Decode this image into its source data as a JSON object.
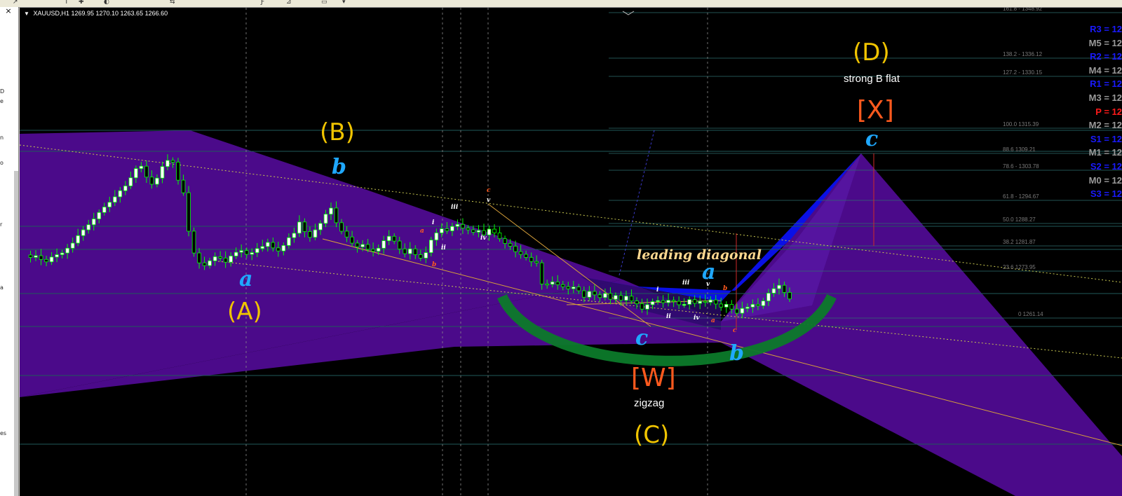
{
  "toolbar": {
    "items": [
      "↗",
      "T",
      "✚",
      "◐",
      "⇆",
      "Ƒ",
      "⊿",
      "▭",
      "▾"
    ]
  },
  "side_panel": {
    "close_glyph": "×",
    "fragments": [
      "D",
      "e",
      "n",
      "o",
      "r",
      "a",
      "es"
    ]
  },
  "chart": {
    "header": {
      "symbol": "XAUUSD,H1",
      "ohlc": "1269.95 1270.10 1263.65 1266.60"
    },
    "fib_levels": [
      {
        "label": "161.8 - 1348.92"
      },
      {
        "label": "138.2 - 1336.12"
      },
      {
        "label": "127.2 - 1330.15"
      },
      {
        "label": "100.0 1315.39"
      },
      {
        "label": "88.6 1309.21"
      },
      {
        "label": "78.6 - 1303.78"
      },
      {
        "label": "61.8 - 1294.67"
      },
      {
        "label": "50.0 1288.27"
      },
      {
        "label": "38.2 1281.87"
      },
      {
        "label": "23.6 1273.95"
      },
      {
        "label": "0 1261.14"
      }
    ],
    "pivots": [
      {
        "label": "R3 = 12",
        "color": "#1a1aff"
      },
      {
        "label": "M5 = 12",
        "color": "#9a9a9a"
      },
      {
        "label": "R2 = 12",
        "color": "#1a1aff"
      },
      {
        "label": "M4 = 12",
        "color": "#9a9a9a"
      },
      {
        "label": "R1 = 12",
        "color": "#1a1aff"
      },
      {
        "label": "M3 = 12",
        "color": "#9a9a9a"
      },
      {
        "label": "P  = 12",
        "color": "#ff1a1a"
      },
      {
        "label": "M2 = 12",
        "color": "#9a9a9a"
      },
      {
        "label": "S1 = 12",
        "color": "#1a1aff"
      },
      {
        "label": "M1 = 12",
        "color": "#9a9a9a"
      },
      {
        "label": "S2 = 12",
        "color": "#1a1aff"
      },
      {
        "label": "M0 = 12",
        "color": "#9a9a9a"
      },
      {
        "label": "S3 = 12",
        "color": "#1a1aff"
      }
    ],
    "labels": {
      "A": "(A)",
      "B": "(B)",
      "C": "(C)",
      "D": "(D)",
      "W": "[W]",
      "X": "[X]",
      "zigzag": "zigzag",
      "strong_b_flat": "strong B flat",
      "leading_diagonal": "leading diagonal",
      "a_left": "a",
      "b_top": "b",
      "c_mid": "c",
      "a_diag": "a",
      "b_low": "b",
      "c_top": "c",
      "small": {
        "iii1": "iii",
        "i1": "i",
        "ii1": "ii",
        "iv1": "iv",
        "v1": "v",
        "c1": "c",
        "a1": "a",
        "b1": "b",
        "i2": "i",
        "ii2": "ii",
        "iii2": "iii",
        "iv2": "iv",
        "v2": "v",
        "a2": "a",
        "b2": "b",
        "c2": "c"
      }
    },
    "colors": {
      "background": "#000000",
      "bull_candle": "#ffffff",
      "bear_candle": "#000000",
      "wick": "#00ff00",
      "purple_zone": "#4b0a8a",
      "blue_zone": "#0a10e6",
      "green_arc": "#0c7a2a",
      "channel_line": "#d7a03a",
      "label_yellow": "#f0c400",
      "label_orange": "#ff5a1e",
      "label_blue": "#1fa8ff"
    },
    "price_path": [
      1279.5,
      1278.8,
      1279.3,
      1278.2,
      1277.5,
      1278.9,
      1279.6,
      1280.1,
      1281.5,
      1283.0,
      1285.2,
      1286.9,
      1288.4,
      1290.1,
      1292.0,
      1293.6,
      1295.0,
      1296.6,
      1298.4,
      1299.8,
      1302.2,
      1304.9,
      1305.6,
      1302.4,
      1300.3,
      1302.1,
      1305.5,
      1307.3,
      1306.8,
      1301.5,
      1297.8,
      1286.5,
      1280.1,
      1277.2,
      1276.4,
      1277.8,
      1279.0,
      1278.6,
      1277.4,
      1279.2,
      1280.3,
      1280.8,
      1279.7,
      1280.2,
      1281.4,
      1282.0,
      1283.2,
      1281.6,
      1280.7,
      1282.3,
      1284.6,
      1285.9,
      1289.2,
      1286.4,
      1284.7,
      1286.9,
      1288.8,
      1291.5,
      1293.3,
      1289.0,
      1286.5,
      1284.8,
      1283.0,
      1281.9,
      1282.6,
      1281.2,
      1280.6,
      1281.5,
      1283.7,
      1285.0,
      1283.6,
      1281.3,
      1279.9,
      1281.3,
      1279.6,
      1278.6,
      1280.2,
      1283.9,
      1286.0,
      1287.2,
      1286.6,
      1287.9,
      1288.5,
      1287.4,
      1286.9,
      1286.2,
      1286.7,
      1285.4,
      1287.1,
      1286.0,
      1284.3,
      1282.9,
      1282.1,
      1280.5,
      1279.7,
      1278.8,
      1277.6,
      1277.2,
      1271.0,
      1270.9,
      1271.6,
      1270.8,
      1270.2,
      1269.6,
      1270.1,
      1269.0,
      1267.1,
      1268.8,
      1267.8,
      1267.0,
      1268.2,
      1266.5,
      1267.6,
      1266.2,
      1267.4,
      1266.0,
      1265.2,
      1263.6,
      1264.9,
      1265.8,
      1266.1,
      1265.5,
      1266.2,
      1265.9,
      1264.9,
      1265.0,
      1266.4,
      1265.3,
      1265.9,
      1265.6,
      1266.3,
      1265.1,
      1264.2,
      1265.0,
      1263.6,
      1262.4,
      1263.8,
      1264.2,
      1265.0,
      1264.6,
      1266.0,
      1268.3,
      1269.6,
      1270.6,
      1268.5,
      1266.6
    ]
  }
}
